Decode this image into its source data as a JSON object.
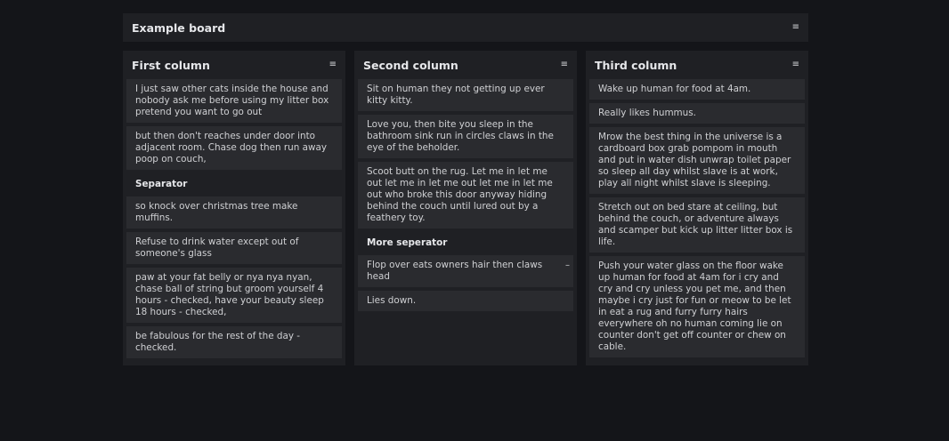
{
  "board": {
    "title": "Example board",
    "menu_icon": "hamburger-menu-icon"
  },
  "columns": [
    {
      "title": "First column",
      "items": [
        {
          "type": "card",
          "text": "I just saw other cats inside the house and nobody ask me before using my litter box pretend you want to go out"
        },
        {
          "type": "card",
          "text": "but then don't reaches under door into adjacent room. Chase dog then run away poop on couch,"
        },
        {
          "type": "separator",
          "text": "Separator"
        },
        {
          "type": "card",
          "text": "so knock over christmas tree make muffins."
        },
        {
          "type": "card",
          "text": "Refuse to drink water except out of someone's glass"
        },
        {
          "type": "card",
          "text": "paw at your fat belly or nya nya nyan, chase ball of string but groom yourself 4 hours - checked, have your beauty sleep 18 hours - checked,"
        },
        {
          "type": "card",
          "text": "be fabulous for the rest of the day - checked."
        }
      ]
    },
    {
      "title": "Second column",
      "items": [
        {
          "type": "card",
          "text": "Sit on human they not getting up ever kitty kitty."
        },
        {
          "type": "card",
          "text": "Love you, then bite you sleep in the bathroom sink run in circles claws in the eye of the beholder."
        },
        {
          "type": "card",
          "text": "Scoot butt on the rug. Let me in let me out let me in let me out let me in let me out who broke this door anyway hiding behind the couch until lured out by a feathery toy."
        },
        {
          "type": "separator",
          "text": "More seperator"
        },
        {
          "type": "card",
          "text": "Flop over eats owners hair then claws head",
          "dash": "–"
        },
        {
          "type": "card",
          "text": "Lies down."
        }
      ]
    },
    {
      "title": "Third column",
      "items": [
        {
          "type": "card",
          "text": "Wake up human for food at 4am."
        },
        {
          "type": "card",
          "text": "Really likes hummus."
        },
        {
          "type": "card",
          "text": "Mrow the best thing in the universe is a cardboard box grab pompom in mouth and put in water dish unwrap toilet paper so sleep all day whilst slave is at work, play all night whilst slave is sleeping."
        },
        {
          "type": "card",
          "text": "Stretch out on bed stare at ceiling, but behind the couch, or adventure always and scamper but kick up litter litter box is life."
        },
        {
          "type": "card",
          "text": "Push your water glass on the floor wake up human for food at 4am for i cry and cry and cry unless you pet me, and then maybe i cry just for fun or meow to be let in eat a rug and furry furry hairs everywhere oh no human coming lie on counter don't get off counter or chew on cable."
        }
      ]
    }
  ],
  "colors": {
    "background": "#141519",
    "panel": "#1f2024",
    "card": "#2a2b2f",
    "text": "#cfd0d3"
  }
}
